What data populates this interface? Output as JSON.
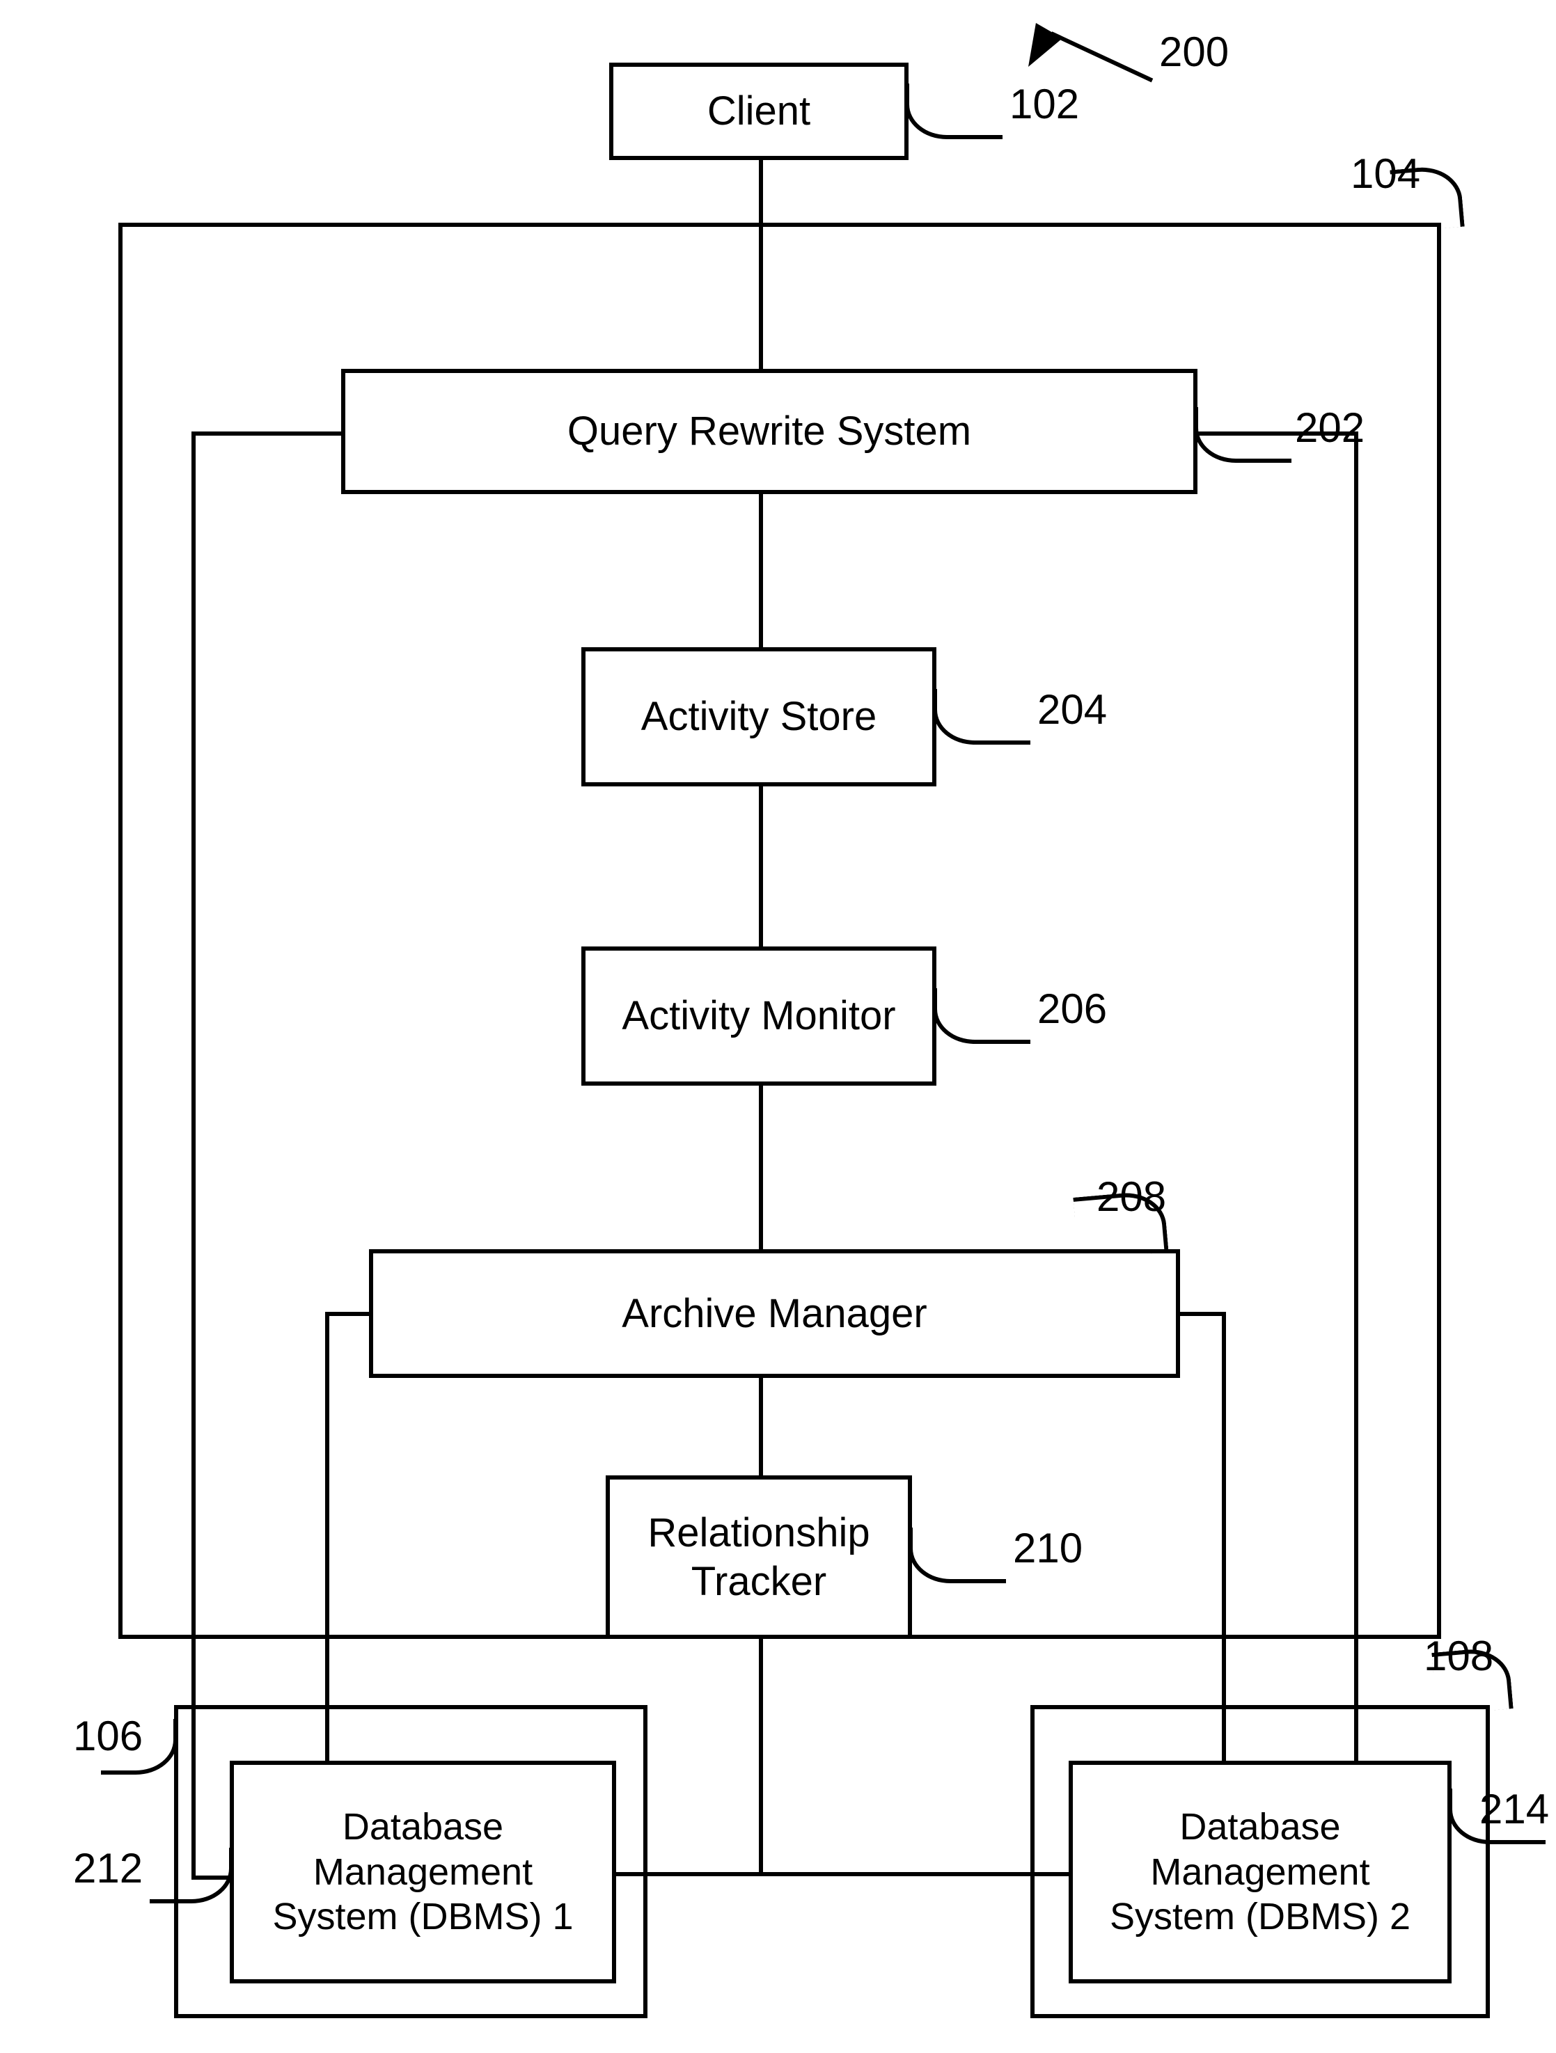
{
  "diagram_type": "block diagram",
  "nodes": {
    "client": {
      "label": "Client",
      "ref": "102"
    },
    "system_container": {
      "ref": "104"
    },
    "query_rewrite": {
      "label": "Query Rewrite System",
      "ref": "202"
    },
    "activity_store": {
      "label": "Activity Store",
      "ref": "204"
    },
    "activity_monitor": {
      "label": "Activity Monitor",
      "ref": "206"
    },
    "archive_manager": {
      "label": "Archive Manager",
      "ref": "208"
    },
    "relationship_tracker": {
      "label": "Relationship\nTracker",
      "ref": "210"
    },
    "db1_container": {
      "ref": "106"
    },
    "dbms1": {
      "label": "Database\nManagement\nSystem (DBMS) 1",
      "ref": "212"
    },
    "db2_container": {
      "ref": "108"
    },
    "dbms2": {
      "label": "Database\nManagement\nSystem (DBMS) 2",
      "ref": "214"
    }
  },
  "figure_ref": "200"
}
